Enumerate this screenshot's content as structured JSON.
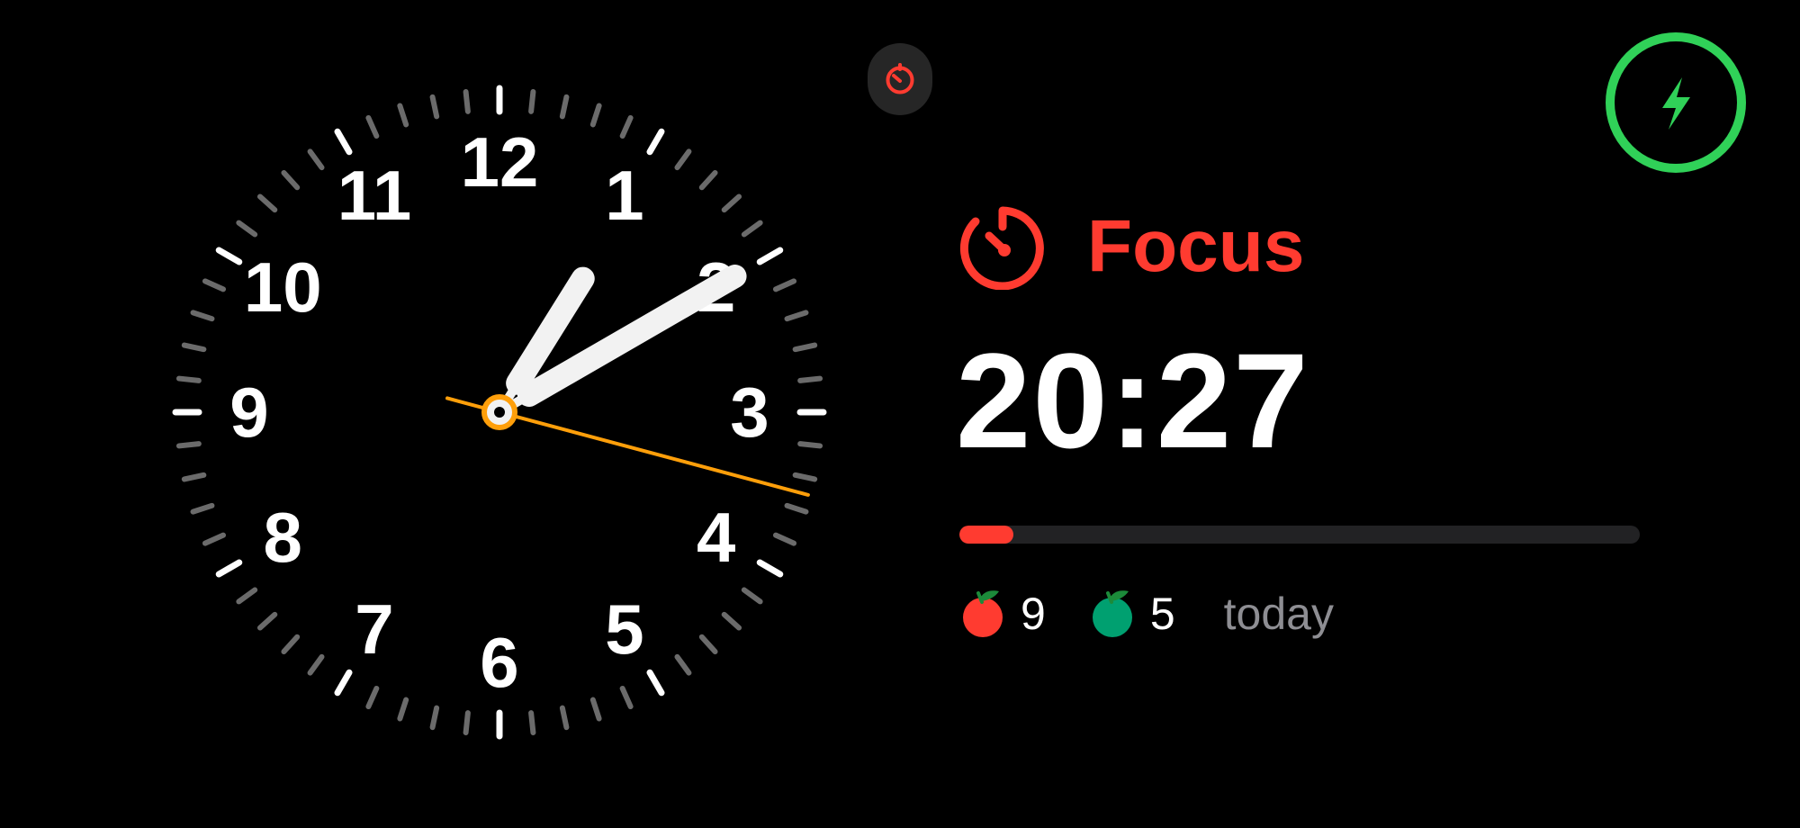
{
  "clock": {
    "numerals": [
      "12",
      "1",
      "2",
      "3",
      "4",
      "5",
      "6",
      "7",
      "8",
      "9",
      "10",
      "11"
    ],
    "hand_color": "#f2f2f2",
    "second_hand_color": "#ff9f0a",
    "tick_color": "#6b6b6b",
    "major_tick_color": "#ffffff"
  },
  "live_activity": {
    "icon": "timer-icon",
    "color": "#ff3b30"
  },
  "charging": {
    "icon": "bolt-icon",
    "color": "#30d158"
  },
  "focus": {
    "icon": "timer-icon",
    "title": "Focus",
    "timer": "20:27",
    "progress": 0.08,
    "accent_color": "#ff3b30",
    "track_color": "#222224"
  },
  "stats": {
    "tomato_red": {
      "icon": "red-tomato-icon",
      "count": "9",
      "color": "#ff3b30"
    },
    "tomato_green": {
      "icon": "green-tomato-icon",
      "count": "5",
      "color": "#00a070"
    },
    "suffix": "today"
  }
}
